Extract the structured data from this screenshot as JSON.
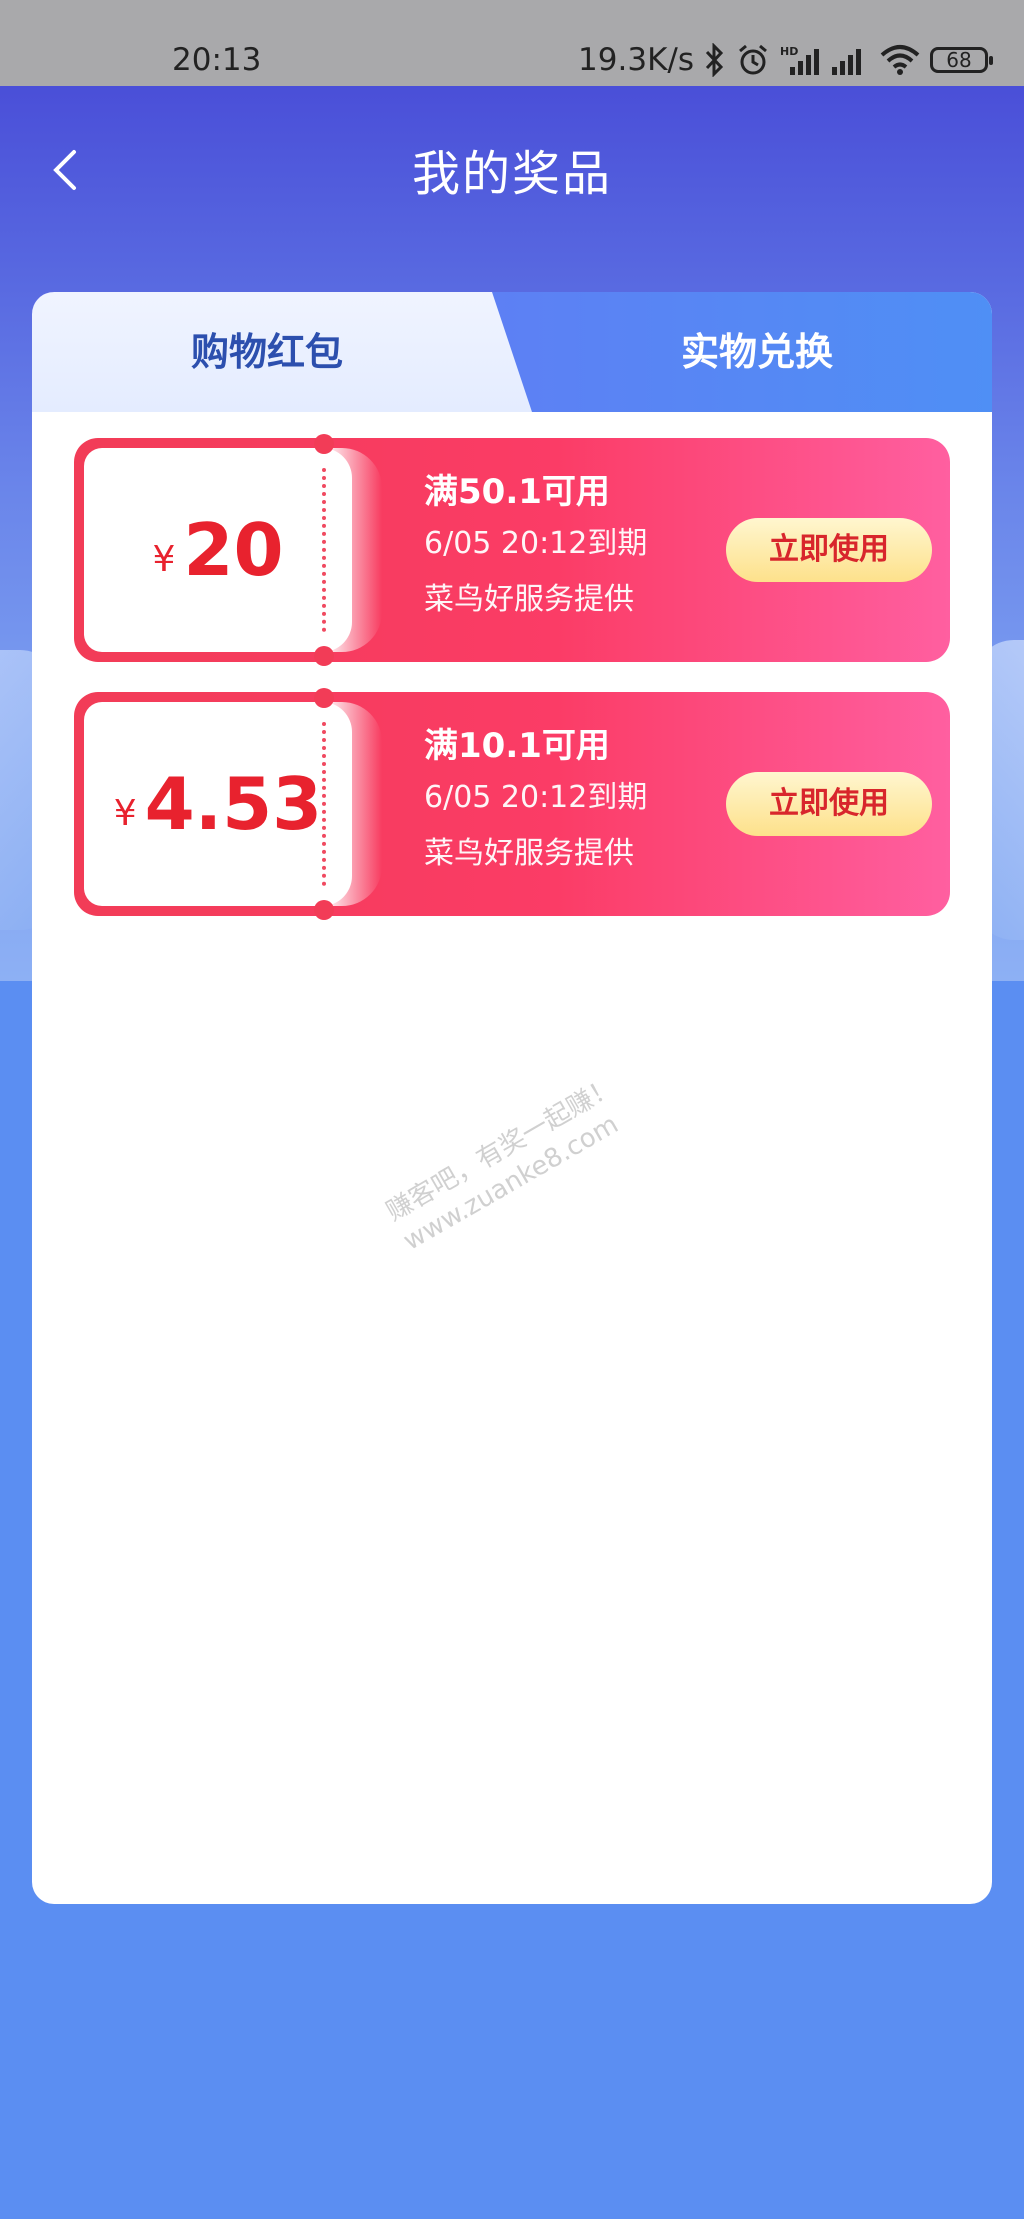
{
  "status_bar": {
    "time": "20:13",
    "net_speed": "19.3K/s",
    "battery": "68"
  },
  "header": {
    "title": "我的奖品",
    "back_icon": "chevron-left-icon"
  },
  "tabs": [
    {
      "label": "购物红包",
      "active": true
    },
    {
      "label": "实物兑换",
      "active": false
    }
  ],
  "coupons": [
    {
      "currency": "¥",
      "amount": "20",
      "condition": "满50.1可用",
      "expiry": "6/05 20:12到期",
      "source": "菜鸟好服务提供",
      "button": "立即使用"
    },
    {
      "currency": "¥",
      "amount": "4.53",
      "condition": "满10.1可用",
      "expiry": "6/05 20:12到期",
      "source": "菜鸟好服务提供",
      "button": "立即使用"
    }
  ],
  "watermark": {
    "line1": "赚客吧，有奖一起赚！",
    "line2": "www.zuanke8.com"
  },
  "colors": {
    "coupon_red": "#f23c57",
    "amount_red": "#e8222e",
    "button_yellow": "#fde18b",
    "page_blue": "#5b8ef2",
    "tab_active_text": "#2c4fae"
  }
}
